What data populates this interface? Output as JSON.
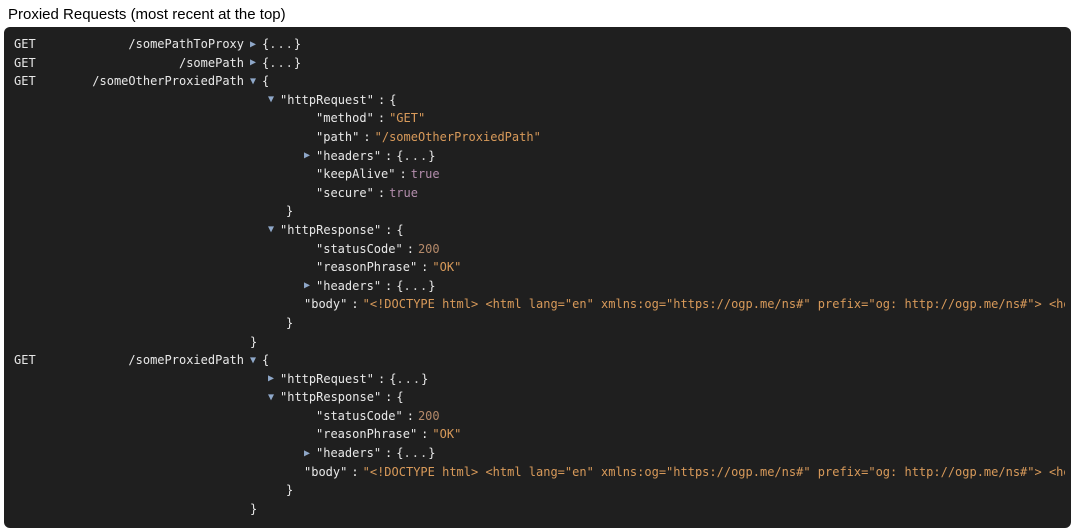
{
  "title": "Proxied Requests (most recent at the top)",
  "ellipsis": "...",
  "requests": [
    {
      "method": "GET",
      "path": "/somePathToProxy",
      "rootExpanded": false
    },
    {
      "method": "GET",
      "path": "/somePath",
      "rootExpanded": false
    },
    {
      "method": "GET",
      "path": "/someOtherProxiedPath",
      "rootExpanded": true,
      "httpRequest": {
        "expanded": true,
        "method": "GET",
        "path": "/someOtherProxiedPath",
        "headersExpanded": false,
        "keepAlive": true,
        "secure": true
      },
      "httpResponse": {
        "expanded": true,
        "statusCode": 200,
        "reasonPhrase": "OK",
        "headersExpanded": false,
        "body": "<!DOCTYPE html> <html lang=\"en\" xmlns:og=\"https://ogp.me/ns#\" prefix=\"og: http://ogp.me/ns#\"> <head> <"
      }
    },
    {
      "method": "GET",
      "path": "/someProxiedPath",
      "rootExpanded": true,
      "httpRequest": {
        "expanded": false
      },
      "httpResponse": {
        "expanded": true,
        "statusCode": 200,
        "reasonPhrase": "OK",
        "headersExpanded": false,
        "body": "<!DOCTYPE html> <html lang=\"en\" xmlns:og=\"https://ogp.me/ns#\" prefix=\"og: http://ogp.me/ns#\"> <head> <"
      }
    }
  ],
  "labels": {
    "httpRequest": "httpRequest",
    "httpResponse": "httpResponse",
    "method": "method",
    "path": "path",
    "headers": "headers",
    "keepAlive": "keepAlive",
    "secure": "secure",
    "statusCode": "statusCode",
    "reasonPhrase": "reasonPhrase",
    "body": "body"
  }
}
